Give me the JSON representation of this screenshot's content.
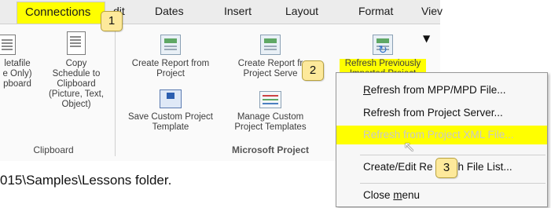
{
  "ribbon": {
    "tabs": {
      "connections": "Connections",
      "edit": "dit",
      "dates": "Dates",
      "insert": "Insert",
      "layout": "Layout",
      "format": "Format",
      "view": "Viev"
    },
    "clipboard_group": {
      "metafile_label": "letafile\ne Only)\npboard",
      "copy_schedule_label": "Copy\nSchedule to\nClipboard\n(Picture, Text,\nObject)",
      "group_label": "Clipboard"
    },
    "project_group": {
      "create_report_label": "Create Report from\nProject",
      "create_report_server_label": "Create Report fr\nProject Serve",
      "refresh_previous_label": "Refresh Previously\nImported Project",
      "save_template_label": "Save Custom Project\nTemplate",
      "manage_templates_label": "Manage Custom\nProject Templates",
      "group_label": "Microsoft Project"
    }
  },
  "menu": {
    "items": [
      {
        "before": "",
        "key": "R",
        "after": "efresh from MPP/MPD File..."
      },
      {
        "before": "Refresh from Project Server...",
        "key": "",
        "after": ""
      },
      {
        "before": "Refresh from Project XML File...",
        "key": "",
        "after": ""
      },
      {
        "before": "Create/Edit Re",
        "key": "",
        "after": "h File List..."
      },
      {
        "before": "Close ",
        "key": "m",
        "after": "enu"
      }
    ]
  },
  "callouts": {
    "one": "1",
    "two": "2",
    "three": "3"
  },
  "body_text": "015\\Samples\\Lessons folder.",
  "colors": {
    "highlight": "#ffff00",
    "callout_fill": "#fde99b"
  },
  "icons": [
    "metafile-icon",
    "copy-schedule-icon",
    "create-report-icon",
    "create-report-server-icon",
    "refresh-icon",
    "save-template-icon",
    "manage-templates-icon",
    "dropdown-arrow-icon",
    "mouse-cursor-icon"
  ]
}
